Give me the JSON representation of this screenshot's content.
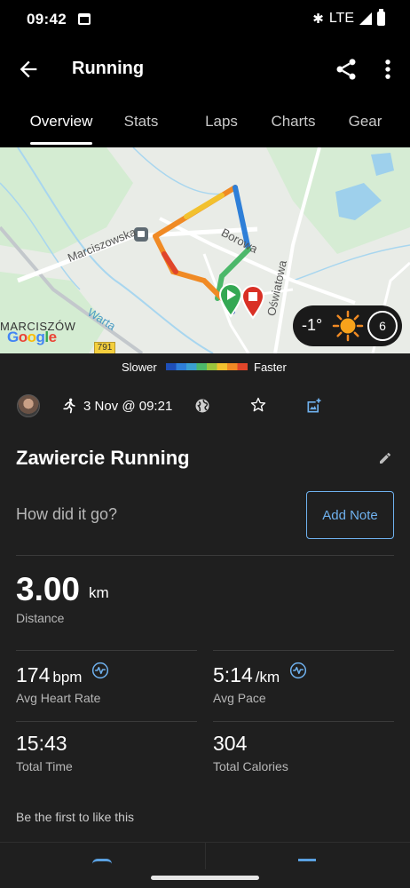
{
  "status_bar": {
    "time": "09:42",
    "network": "LTE",
    "icons": [
      "calendar-icon",
      "bluetooth-icon",
      "signal-icon",
      "battery-icon"
    ]
  },
  "app_bar": {
    "title": "Running",
    "icons": [
      "back-arrow-icon",
      "share-icon",
      "more-vert-icon"
    ]
  },
  "tabs": [
    {
      "label": "Overview",
      "active": true
    },
    {
      "label": "Stats",
      "active": false
    },
    {
      "label": "Laps",
      "active": false
    },
    {
      "label": "Charts",
      "active": false
    },
    {
      "label": "Gear",
      "active": false
    }
  ],
  "map": {
    "labels": {
      "marciszowska": "Marciszowska",
      "borowa": "Borowa",
      "oswiatowa": "Oświatowa",
      "warta": "Warta",
      "marciszow": "MARCISZÓW",
      "google": "Google",
      "road_number": "791"
    },
    "weather": {
      "temperature": "-1°",
      "condition_icon": "sun-icon",
      "wind": "6"
    }
  },
  "pace_legend": {
    "slower": "Slower",
    "faster": "Faster",
    "colors": [
      "#1e4fb8",
      "#2e7fd8",
      "#3aa0d0",
      "#4cb86a",
      "#9bc53d",
      "#f2c12e",
      "#f08a24",
      "#e0462a"
    ]
  },
  "activity": {
    "date": "3 Nov @ 09:21",
    "title": "Zawiercie Running",
    "note_prompt": "How did it go?",
    "add_note_label": "Add Note",
    "distance": {
      "value": "3.00",
      "unit": "km",
      "label": "Distance"
    },
    "avg_heart_rate": {
      "value": "174",
      "unit": "bpm",
      "label": "Avg Heart Rate"
    },
    "avg_pace": {
      "value": "5:14",
      "unit": "/km",
      "label": "Avg Pace"
    },
    "total_time": {
      "value": "15:43",
      "label": "Total Time"
    },
    "total_calories": {
      "value": "304",
      "label": "Total Calories"
    },
    "likes_text": "Be the first to like this"
  },
  "colors": {
    "background": "#1f1f1f",
    "accent": "#6fb1ee",
    "start_marker": "#34a853",
    "end_marker": "#d93025"
  }
}
